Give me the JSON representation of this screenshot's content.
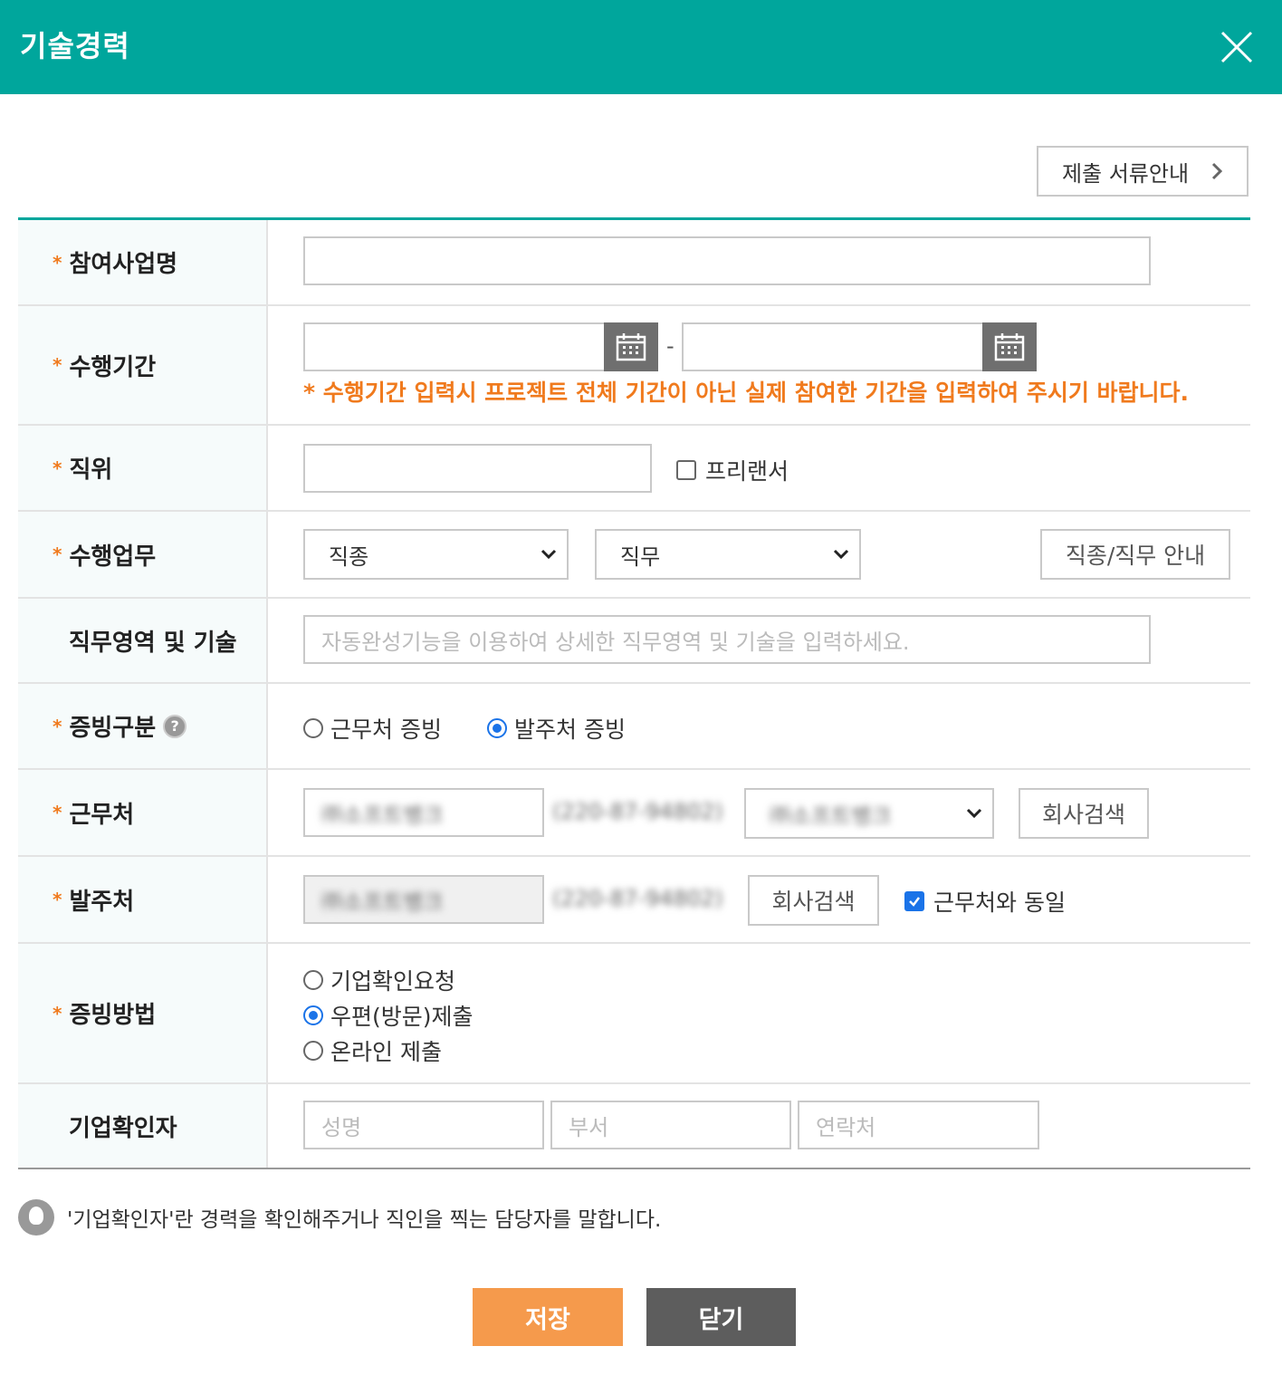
{
  "header": {
    "title": "기술경력"
  },
  "guide_button": {
    "label": "제출 서류안내"
  },
  "rows": {
    "project_name": {
      "label": "참여사업명",
      "required": "*"
    },
    "period": {
      "label": "수행기간",
      "required": "*",
      "separator": "-",
      "notice": "* 수행기간 입력시 프로젝트 전체 기간이 아닌 실제 참여한 기간을 입력하여 주시기 바랍니다."
    },
    "position": {
      "label": "직위",
      "required": "*",
      "freelancer_label": "프리랜서"
    },
    "duty": {
      "label": "수행업무",
      "required": "*",
      "job_type_selected": "직종",
      "job_selected": "직무",
      "guide_label": "직종/직무 안내"
    },
    "skills": {
      "label": "직무영역 및 기술",
      "placeholder": "자동완성기능을 이용하여 상세한 직무영역 및 기술을 입력하세요."
    },
    "proof_type": {
      "label": "증빙구분",
      "required": "*",
      "help": "?",
      "options": [
        "근무처 증빙",
        "발주처 증빙"
      ],
      "selected": "발주처 증빙"
    },
    "workplace": {
      "label": "근무처",
      "required": "*",
      "company": "㈜소프트뱅크",
      "biz_no": "(220-87-94802)",
      "select_value": "㈜소프트뱅크",
      "search_label": "회사검색"
    },
    "orderer": {
      "label": "발주처",
      "required": "*",
      "company": "㈜소프트뱅크",
      "biz_no": "(220-87-94802)",
      "search_label": "회사검색",
      "same_label": "근무처와 동일",
      "same_checked": true
    },
    "proof_method": {
      "label": "증빙방법",
      "required": "*",
      "options": [
        "기업확인요청",
        "우편(방문)제출",
        "온라인 제출"
      ],
      "selected": "우편(방문)제출"
    },
    "confirmer": {
      "label": "기업확인자",
      "name_placeholder": "성명",
      "dept_placeholder": "부서",
      "contact_placeholder": "연락처"
    }
  },
  "tip": {
    "text": "'기업확인자'란 경력을 확인해주거나 직인을 찍는 담당자를 말합니다."
  },
  "buttons": {
    "save": "저장",
    "close": "닫기"
  },
  "colors": {
    "accent": "#00a69c",
    "required": "#f07a1d",
    "save": "#f59a4c",
    "close": "#5d5d5d"
  }
}
